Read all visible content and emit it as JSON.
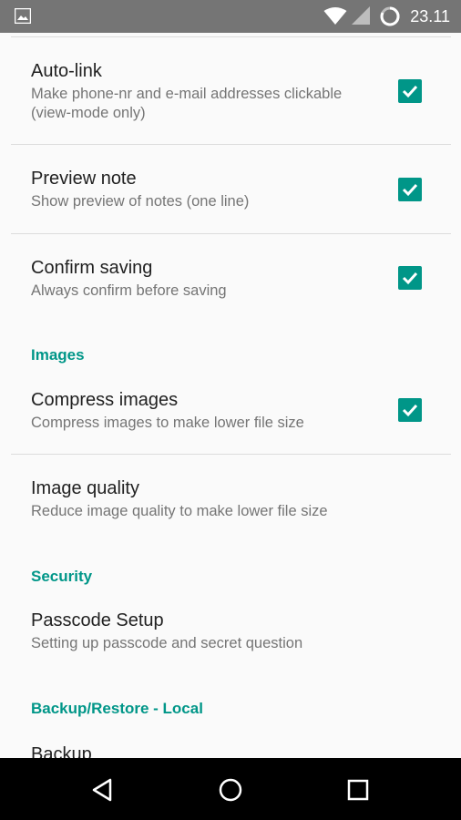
{
  "status_bar": {
    "time": "23.11",
    "icons": [
      "image-icon",
      "wifi-icon",
      "cell-signal-icon",
      "battery-icon"
    ]
  },
  "preferences": {
    "autolink": {
      "title": "Auto-link",
      "summary": "Make phone-nr and e-mail addresses clickable (view-mode only)",
      "checked": true
    },
    "preview_note": {
      "title": "Preview note",
      "summary": "Show preview of notes (one line)",
      "checked": true
    },
    "confirm_saving": {
      "title": "Confirm saving",
      "summary": "Always confirm before saving",
      "checked": true
    },
    "images_category": "Images",
    "compress_images": {
      "title": "Compress images",
      "summary": "Compress images to make lower file size",
      "checked": true
    },
    "image_quality": {
      "title": "Image quality",
      "summary": "Reduce image quality to make lower file size"
    },
    "security_category": "Security",
    "passcode_setup": {
      "title": "Passcode Setup",
      "summary": "Setting up passcode and secret question"
    },
    "backup_category": "Backup/Restore - Local",
    "backup": {
      "title": "Backup"
    }
  },
  "nav_bar": {
    "buttons": [
      "back-icon",
      "home-icon",
      "recents-icon"
    ]
  },
  "colors": {
    "accent": "#009688",
    "status_bar": "#757575",
    "nav_bar": "#000000",
    "background": "#fafafa"
  }
}
